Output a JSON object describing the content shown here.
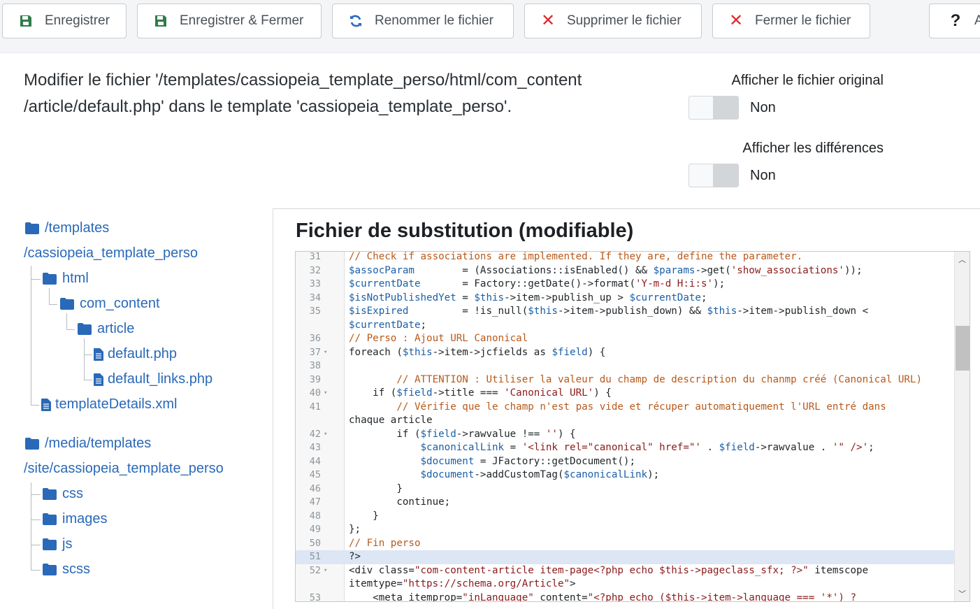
{
  "toolbar": {
    "buttons": [
      {
        "label": "Enregistrer",
        "icon": "save-icon"
      },
      {
        "label": "Enregistrer & Fermer",
        "icon": "save-icon"
      },
      {
        "label": "Renommer le fichier",
        "icon": "sync-icon"
      },
      {
        "label": "Supprimer le fichier",
        "icon": "times-icon"
      },
      {
        "label": "Fermer le fichier",
        "icon": "times-icon"
      },
      {
        "label": "A",
        "icon": "question-icon"
      }
    ]
  },
  "header": {
    "description_line1": "Modifier le fichier '/templates/cassiopeia_template_perso/html/com_content",
    "description_line2": "/article/default.php' dans le template 'cassiopeia_template_perso'."
  },
  "options": {
    "show_original": {
      "label": "Afficher le fichier original",
      "value": "Non"
    },
    "show_diff": {
      "label": "Afficher les différences",
      "value": "Non"
    }
  },
  "tree": {
    "templates_root_line1": "/templates",
    "templates_root_line2": "/cassiopeia_template_perso",
    "html": "html",
    "com_content": "com_content",
    "article": "article",
    "default_php": "default.php",
    "default_links_php": "default_links.php",
    "template_details": "templateDetails.xml",
    "media_root_line1": "/media/templates",
    "media_root_line2": "/site/cassiopeia_template_perso",
    "css": "css",
    "images": "images",
    "js": "js",
    "scss": "scss"
  },
  "editor": {
    "title": "Fichier de substitution (modifiable)",
    "lines": [
      {
        "n": "31",
        "fold": false,
        "text": "// Check if associations are implemented. If they are, define the parameter."
      },
      {
        "n": "32",
        "fold": false,
        "text": "$assocParam        = (Associations::isEnabled() && $params->get('show_associations'));"
      },
      {
        "n": "33",
        "fold": false,
        "text": "$currentDate       = Factory::getDate()->format('Y-m-d H:i:s');"
      },
      {
        "n": "34",
        "fold": false,
        "text": "$isNotPublishedYet = $this->item->publish_up > $currentDate;"
      },
      {
        "n": "35",
        "fold": false,
        "text": "$isExpired         = !is_null($this->item->publish_down) && $this->item->publish_down <"
      },
      {
        "n": "",
        "fold": false,
        "text": "$currentDate;"
      },
      {
        "n": "36",
        "fold": false,
        "text": "// Perso : Ajout URL Canonical"
      },
      {
        "n": "37",
        "fold": true,
        "text": "foreach ($this->item->jcfields as $field) {"
      },
      {
        "n": "38",
        "fold": false,
        "text": ""
      },
      {
        "n": "39",
        "fold": false,
        "text": "        // ATTENTION : Utiliser la valeur du champ de description du chanmp créé (Canonical URL)"
      },
      {
        "n": "40",
        "fold": true,
        "text": "    if ($field->title === 'Canonical URL') {"
      },
      {
        "n": "41",
        "fold": false,
        "text": "        // Vérifie que le champ n'est pas vide et récuper automatiquement l'URL entré dans"
      },
      {
        "n": "",
        "fold": false,
        "text": "chaque article"
      },
      {
        "n": "42",
        "fold": true,
        "text": "        if ($field->rawvalue !== '') {"
      },
      {
        "n": "43",
        "fold": false,
        "text": "            $canonicalLink = '<link rel=\"canonical\" href=\"' . $field->rawvalue . '\" />';"
      },
      {
        "n": "44",
        "fold": false,
        "text": "            $document = JFactory::getDocument();"
      },
      {
        "n": "45",
        "fold": false,
        "text": "            $document->addCustomTag($canonicalLink);"
      },
      {
        "n": "46",
        "fold": false,
        "text": "        }"
      },
      {
        "n": "47",
        "fold": false,
        "text": "        continue;"
      },
      {
        "n": "48",
        "fold": false,
        "text": "    }"
      },
      {
        "n": "49",
        "fold": false,
        "text": "};"
      },
      {
        "n": "50",
        "fold": false,
        "text": "// Fin perso"
      },
      {
        "n": "51",
        "fold": false,
        "text": "?>"
      },
      {
        "n": "52",
        "fold": true,
        "text": "<div class=\"com-content-article item-page<?php echo $this->pageclass_sfx; ?>\" itemscope"
      },
      {
        "n": "",
        "fold": false,
        "text": "itemtype=\"https://schema.org/Article\">"
      },
      {
        "n": "53",
        "fold": false,
        "text": "    <meta itemprop=\"inLanguage\" content=\"<?php echo ($this->item->language === '*') ?"
      }
    ]
  },
  "colors": {
    "accent": "#2a69b8",
    "danger": "#dc2a2a",
    "save_green": "#2f7d4a",
    "comment": "#b8591a",
    "variable": "#1a5fa8"
  }
}
